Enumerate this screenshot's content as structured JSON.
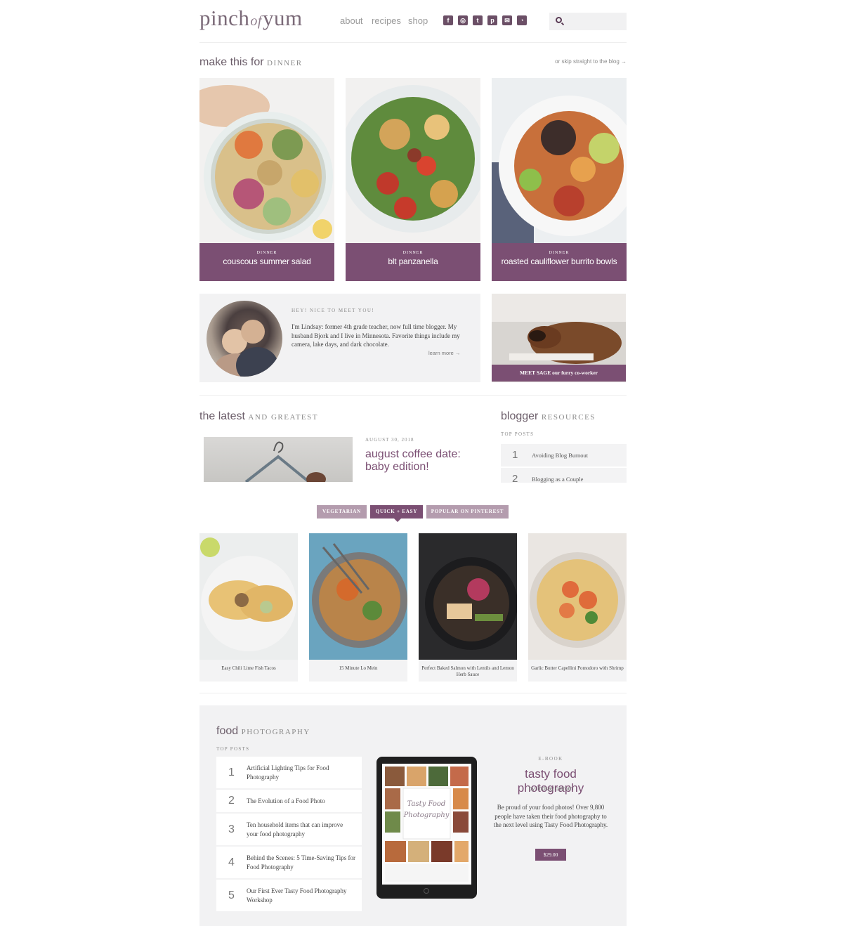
{
  "header": {
    "logo_pinch": "pinch",
    "logo_of": "of",
    "logo_yum": "yum",
    "nav": [
      "about",
      "recipes",
      "shop"
    ],
    "social_icons": [
      "facebook-icon",
      "instagram-icon",
      "twitter-icon",
      "pinterest-icon",
      "email-icon",
      "rss-icon"
    ],
    "search_placeholder": ""
  },
  "dinner": {
    "title_main": "make this for",
    "title_caps": "dinner",
    "skip_link": "or skip straight to the blog →",
    "cards": [
      {
        "category": "DINNER",
        "title": "couscous summer salad"
      },
      {
        "category": "DINNER",
        "title": "blt panzanella"
      },
      {
        "category": "DINNER",
        "title": "roasted cauliflower burrito bowls"
      }
    ]
  },
  "about": {
    "heading": "HEY! NICE TO MEET YOU!",
    "body": "I'm Lindsay: former 4th grade teacher, now full time blogger. My husband Bjork and I live in Minnesota. Favorite things include my camera, lake days, and dark chocolate.",
    "learn_more": "learn more →",
    "dog_caption": "MEET SAGE our furry co-worker"
  },
  "latest": {
    "title_main": "the latest",
    "title_caps": "and greatest",
    "post_date": "AUGUST 30, 2018",
    "post_title": "august coffee date: baby edition!"
  },
  "resources": {
    "title_main": "blogger",
    "title_caps": "resources",
    "top_label": "TOP POSTS",
    "items": [
      {
        "num": "1",
        "text": "Avoiding Blog Burnout"
      },
      {
        "num": "2",
        "text": "Blogging as a Couple"
      }
    ]
  },
  "tabs": [
    {
      "label": "VEGETARIAN",
      "active": false
    },
    {
      "label": "QUICK + EASY",
      "active": true
    },
    {
      "label": "POPULAR ON PINTEREST",
      "active": false
    }
  ],
  "recipes": [
    {
      "title": "Easy Chili Lime Fish Tacos"
    },
    {
      "title": "15 Minute Lo Mein"
    },
    {
      "title": "Perfect Baked Salmon with Lentils and Lemon Herb Sauce"
    },
    {
      "title": "Garlic Butter Capellini Pomodoro with Shrimp"
    }
  ],
  "food_photography": {
    "title_main": "food",
    "title_caps": "photography",
    "top_label": "TOP POSTS",
    "items": [
      {
        "num": "1",
        "text": "Artificial Lighting Tips for Food Photography"
      },
      {
        "num": "2",
        "text": "The Evolution of a Food Photo"
      },
      {
        "num": "3",
        "text": "Ten household items that can improve your food photography"
      },
      {
        "num": "4",
        "text": "Behind the Scenes: 5 Time-Saving Tips for Food Photography"
      },
      {
        "num": "5",
        "text": "Our First Ever Tasty Food Photography Workshop"
      }
    ],
    "ebook_label": "E-BOOK",
    "ebook_title": "tasty food photography",
    "ebook_by": "by lindsay ostrom",
    "ebook_desc": "Be proud of your food photos! Over 9,800 people have taken their food photography to the next level using Tasty Food Photography.",
    "price": "$29.00"
  },
  "colors": {
    "brand_plum": "#7b4f73",
    "tab_inactive": "#b49cae",
    "panel_gray": "#f2f2f3"
  }
}
